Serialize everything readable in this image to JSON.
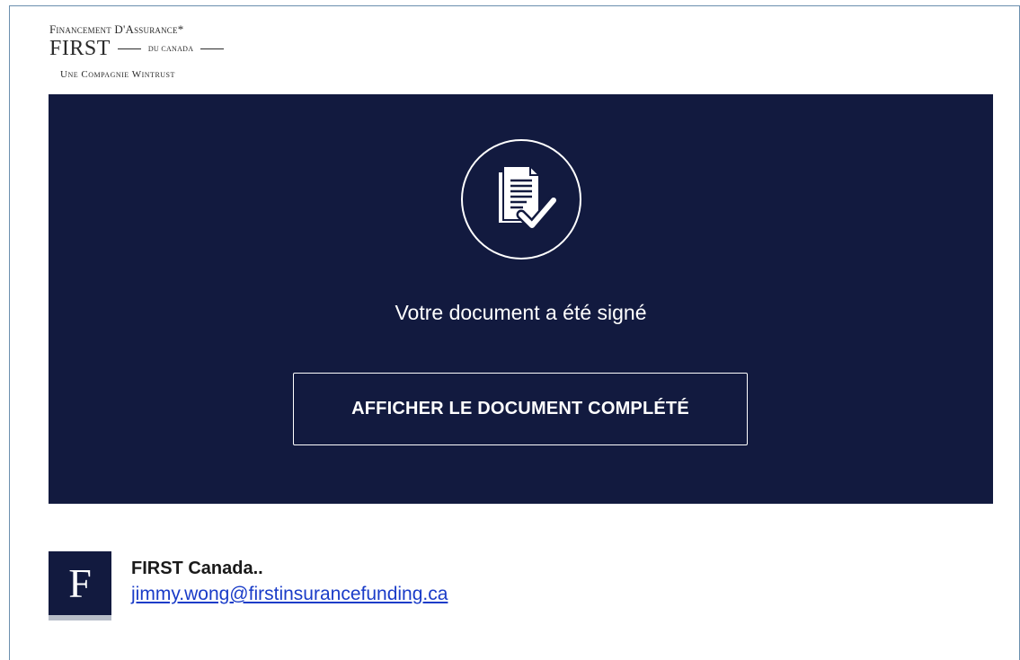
{
  "logo": {
    "line1": "Financement D'Assurance*",
    "first": "FIRST",
    "du_canada": "DU CANADA",
    "line3": "Une Compagnie Wintrust"
  },
  "hero": {
    "icon": "document-check-icon",
    "message": "Votre document a été signé",
    "button_label": "AFFICHER LE DOCUMENT COMPLÉTÉ"
  },
  "sender": {
    "avatar_letter": "F",
    "name": "FIRST Canada..",
    "email": "jimmy.wong@firstinsurancefunding.ca"
  },
  "colors": {
    "hero_background": "#121a3f",
    "link": "#1a3cc8",
    "frame_border": "#6b8fae"
  }
}
